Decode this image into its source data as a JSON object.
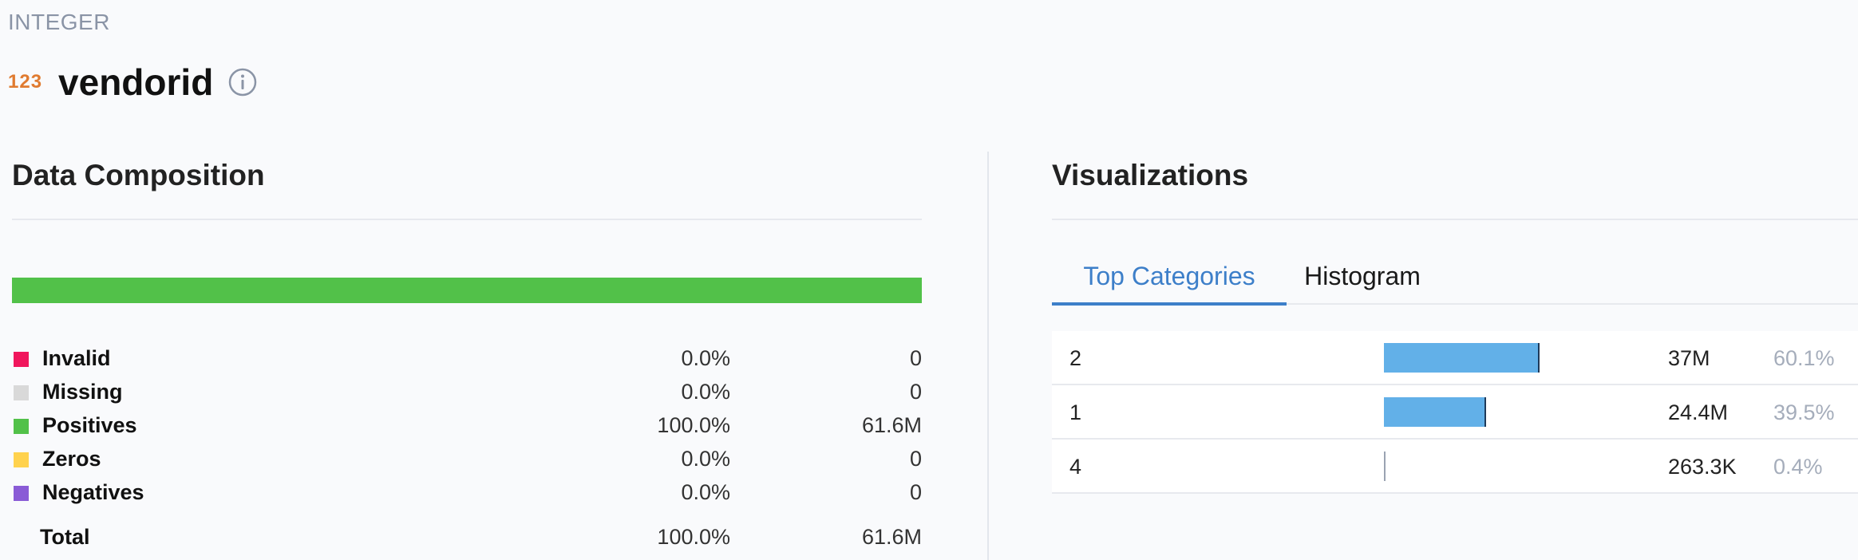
{
  "header": {
    "type_label": "INTEGER",
    "type_badge": "123",
    "column_name": "vendorid",
    "info_icon": "info-icon"
  },
  "composition": {
    "heading": "Data Composition",
    "rows": [
      {
        "name": "Invalid",
        "pct": "0.0%",
        "count": "0",
        "color": "#f0165c",
        "fraction": 0.0
      },
      {
        "name": "Missing",
        "pct": "0.0%",
        "count": "0",
        "color": "#d9d9d9",
        "fraction": 0.0
      },
      {
        "name": "Positives",
        "pct": "100.0%",
        "count": "61.6M",
        "color": "#52c149",
        "fraction": 1.0
      },
      {
        "name": "Zeros",
        "pct": "0.0%",
        "count": "0",
        "color": "#ffd24d",
        "fraction": 0.0
      },
      {
        "name": "Negatives",
        "pct": "0.0%",
        "count": "0",
        "color": "#8a5bd6",
        "fraction": 0.0
      }
    ],
    "total": {
      "name": "Total",
      "pct": "100.0%",
      "count": "61.6M"
    }
  },
  "visualizations": {
    "heading": "Visualizations",
    "tabs": [
      {
        "label": "Top Categories",
        "active": true
      },
      {
        "label": "Histogram",
        "active": false
      }
    ],
    "accent_color": "#3d7fc9",
    "bar_color": "#62b0e8"
  },
  "chart_data": {
    "type": "bar",
    "categories": [
      "2",
      "1",
      "4"
    ],
    "counts": [
      "37M",
      "24.4M",
      "263.3K"
    ],
    "percents": [
      "60.1%",
      "39.5%",
      "0.4%"
    ],
    "values": [
      60.1,
      39.5,
      0.4
    ]
  }
}
